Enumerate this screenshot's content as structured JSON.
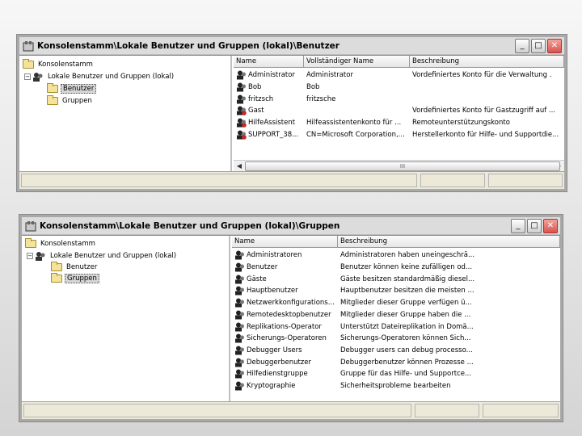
{
  "window1": {
    "title": "Konsolenstamm\\Lokale Benutzer und Gruppen (lokal)\\Benutzer",
    "tree": {
      "root": "Konsolenstamm",
      "node": "Lokale Benutzer und Gruppen (lokal)",
      "children": [
        "Benutzer",
        "Gruppen"
      ],
      "selected": "Benutzer"
    },
    "columns": [
      "Name",
      "Vollständiger Name",
      "Beschreibung"
    ],
    "rows": [
      {
        "name": "Administrator",
        "full": "Administrator",
        "desc": "Vordefiniertes Konto für die Verwaltung ."
      },
      {
        "name": "Bob",
        "full": "Bob",
        "desc": ""
      },
      {
        "name": "fritzsch",
        "full": "fritzsche",
        "desc": ""
      },
      {
        "name": "Gast",
        "full": "",
        "desc": "Vordefiniertes Konto für Gastzugriff auf ..."
      },
      {
        "name": "HilfeAssistent",
        "full": "Hilfeassistentenkonto für ...",
        "desc": "Remoteunterstützungskonto"
      },
      {
        "name": "SUPPORT_38...",
        "full": "CN=Microsoft Corporation,...",
        "desc": "Herstellerkonto für Hilfe- und Supportdie..."
      }
    ],
    "scroll_label": "III"
  },
  "window2": {
    "title": "Konsolenstamm\\Lokale Benutzer und Gruppen (lokal)\\Gruppen",
    "tree": {
      "root": "Konsolenstamm",
      "node": "Lokale Benutzer und Gruppen (lokal)",
      "children": [
        "Benutzer",
        "Gruppen"
      ],
      "selected": "Gruppen"
    },
    "columns": [
      "Name",
      "Beschreibung"
    ],
    "rows": [
      {
        "name": "Administratoren",
        "desc": "Administratoren haben uneingeschrä..."
      },
      {
        "name": "Benutzer",
        "desc": "Benutzer können keine zufälligen od..."
      },
      {
        "name": "Gäste",
        "desc": "Gäste besitzen standardmäßig diesel..."
      },
      {
        "name": "Hauptbenutzer",
        "desc": "Hauptbenutzer besitzen die meisten ..."
      },
      {
        "name": "Netzwerkkonfigurations...",
        "desc": "Mitglieder dieser Gruppe verfügen ü..."
      },
      {
        "name": "Remotedesktopbenutzer",
        "desc": "Mitglieder dieser Gruppe haben die ..."
      },
      {
        "name": "Replikations-Operator",
        "desc": "Unterstützt Dateireplikation in Domä..."
      },
      {
        "name": "Sicherungs-Operatoren",
        "desc": "Sicherungs-Operatoren können Sich..."
      },
      {
        "name": "Debugger Users",
        "desc": "Debugger users can debug processo..."
      },
      {
        "name": "Debuggerbenutzer",
        "desc": "Debuggerbenutzer können Prozesse ..."
      },
      {
        "name": "Hilfedienstgruppe",
        "desc": "Gruppe für das Hilfe- und Supportce..."
      },
      {
        "name": "Kryptographie",
        "desc": "Sicherheitsprobleme bearbeiten"
      }
    ]
  },
  "controls": {
    "minimize": "_",
    "maximize": "□",
    "close": "✕"
  },
  "icons": {
    "title": "console-icon",
    "folder": "folder-icon",
    "users": "users-icon",
    "user": "user-icon",
    "group": "group-icon"
  }
}
